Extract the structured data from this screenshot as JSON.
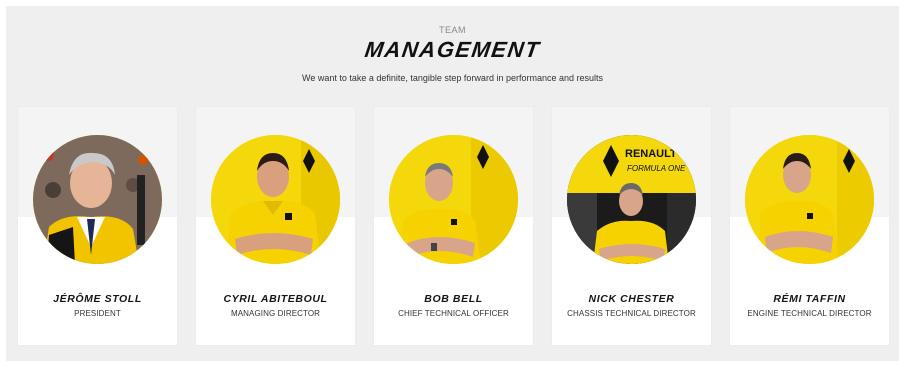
{
  "header": {
    "eyebrow": "TEAM",
    "title": "MANAGEMENT",
    "subtitle": "We want to take a definite, tangible step forward in performance and results"
  },
  "team": [
    {
      "name": "JÉRÔME STOLL",
      "role": "PRESIDENT",
      "photo": "portrait-grey-haired-man-crowd-background"
    },
    {
      "name": "CYRIL ABITEBOUL",
      "role": "MANAGING DIRECTOR",
      "photo": "portrait-man-yellow-polo-arms-crossed"
    },
    {
      "name": "BOB BELL",
      "role": "CHIEF TECHNICAL OFFICER",
      "photo": "portrait-man-yellow-polo-arms-crossed"
    },
    {
      "name": "NICK CHESTER",
      "role": "CHASSIS TECHNICAL DIRECTOR",
      "photo": "portrait-man-yellow-polo-renault-sign"
    },
    {
      "name": "RÉMI TAFFIN",
      "role": "ENGINE TECHNICAL DIRECTOR",
      "photo": "portrait-man-yellow-polo-arms-crossed"
    }
  ],
  "colors": {
    "background": "#efefef",
    "card": "#ffffff",
    "brand_yellow": "#f2d40a"
  }
}
